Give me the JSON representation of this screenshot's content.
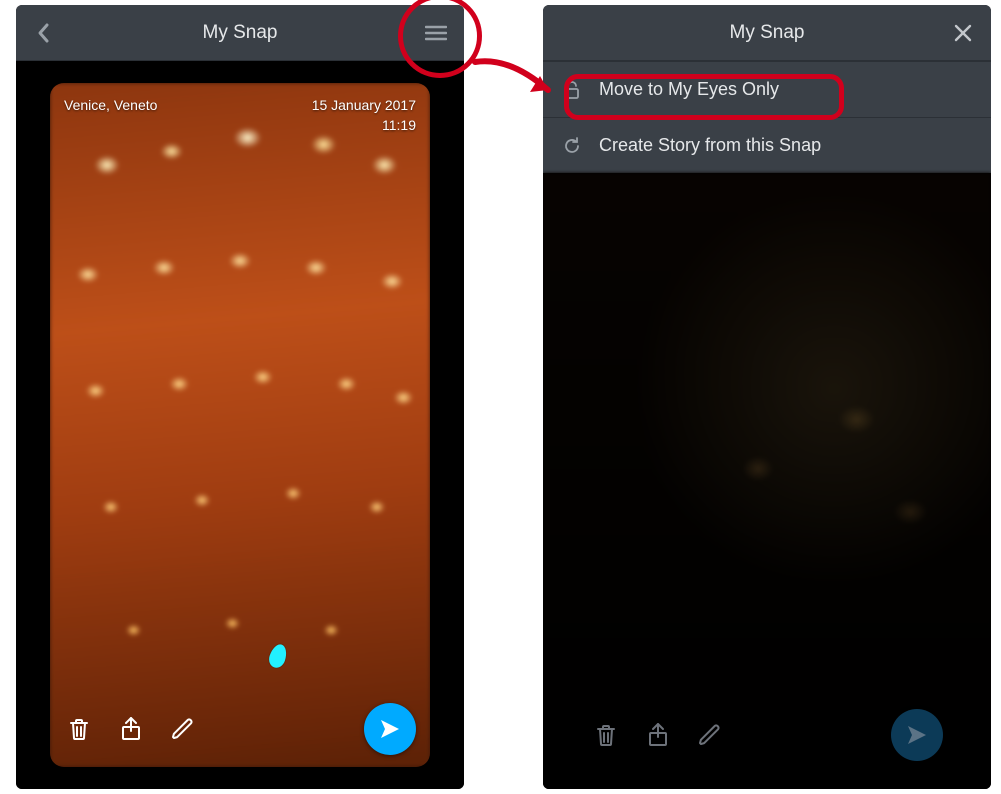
{
  "colors": {
    "accent": "#00aaff",
    "annotation": "#d1001c",
    "chrome": "#3a4047"
  },
  "left_screen": {
    "title": "My Snap",
    "overlay": {
      "location": "Venice, Veneto",
      "date": "15 January 2017",
      "time": "11:19"
    }
  },
  "right_screen": {
    "title": "My Snap",
    "menu": {
      "items": [
        {
          "icon": "lock-icon",
          "label": "Move to My Eyes Only"
        },
        {
          "icon": "refresh-icon",
          "label": "Create Story from this Snap"
        }
      ]
    }
  }
}
